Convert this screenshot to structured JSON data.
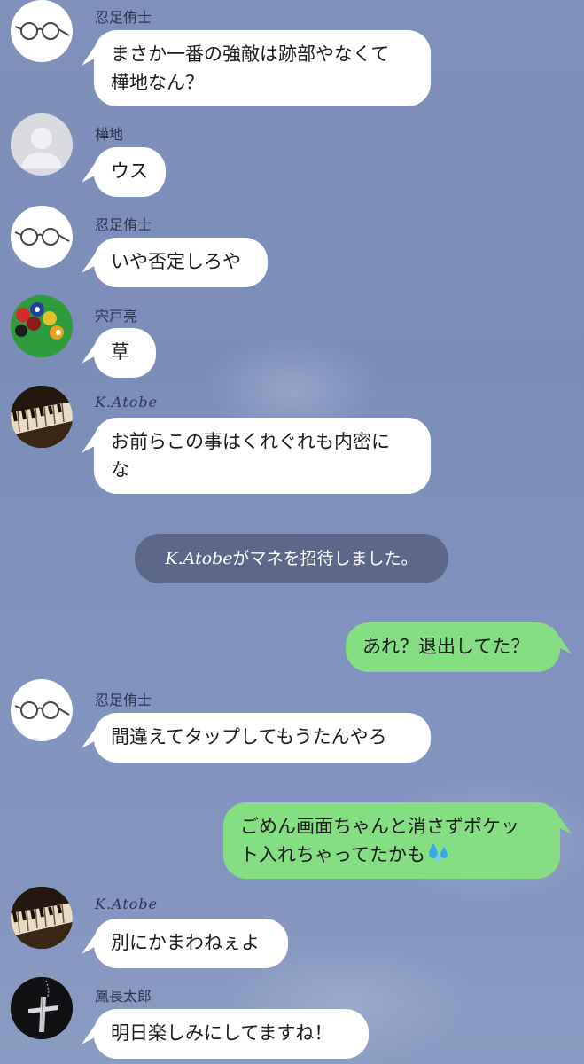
{
  "colors": {
    "background": "#7f90bb",
    "incoming_bubble": "#ffffff",
    "outgoing_bubble": "#85df82",
    "system_bubble": "#556080"
  },
  "messages": [
    {
      "side": "left",
      "sender": "忍足侑士",
      "avatar": "glasses-icon",
      "text": "まさか一番の強敵は跡部やなくて\n樺地なん？"
    },
    {
      "side": "left",
      "sender": "樺地",
      "avatar": "default-user-icon",
      "text": "ウス"
    },
    {
      "side": "left",
      "sender": "忍足侑士",
      "avatar": "glasses-icon",
      "text": "いや否定しろや"
    },
    {
      "side": "left",
      "sender": "宍戸亮",
      "avatar": "billiard-balls-image",
      "text": "草"
    },
    {
      "side": "left",
      "sender": "K.Atobe",
      "avatar": "piano-keys-image",
      "text": "お前らこの事はくれぐれも内密に\nな"
    },
    {
      "side": "system",
      "actor": "K.Atobe",
      "text": "がマネを招待しました。"
    },
    {
      "side": "right",
      "text": "あれ？退出してた？"
    },
    {
      "side": "left",
      "sender": "忍足侑士",
      "avatar": "glasses-icon",
      "text": "間違えてタップしてもうたんやろ"
    },
    {
      "side": "right",
      "text": "ごめん画面ちゃんと消さずポケッ\nト入れちゃってたかも",
      "emoji": "sweat-drops-icon"
    },
    {
      "side": "left",
      "sender": "K.Atobe",
      "avatar": "piano-keys-image",
      "text": "別にかまわねぇよ"
    },
    {
      "side": "left",
      "sender": "鳳長太郎",
      "avatar": "cross-necklace-image",
      "text": "明日楽しみにしてますね！"
    }
  ]
}
